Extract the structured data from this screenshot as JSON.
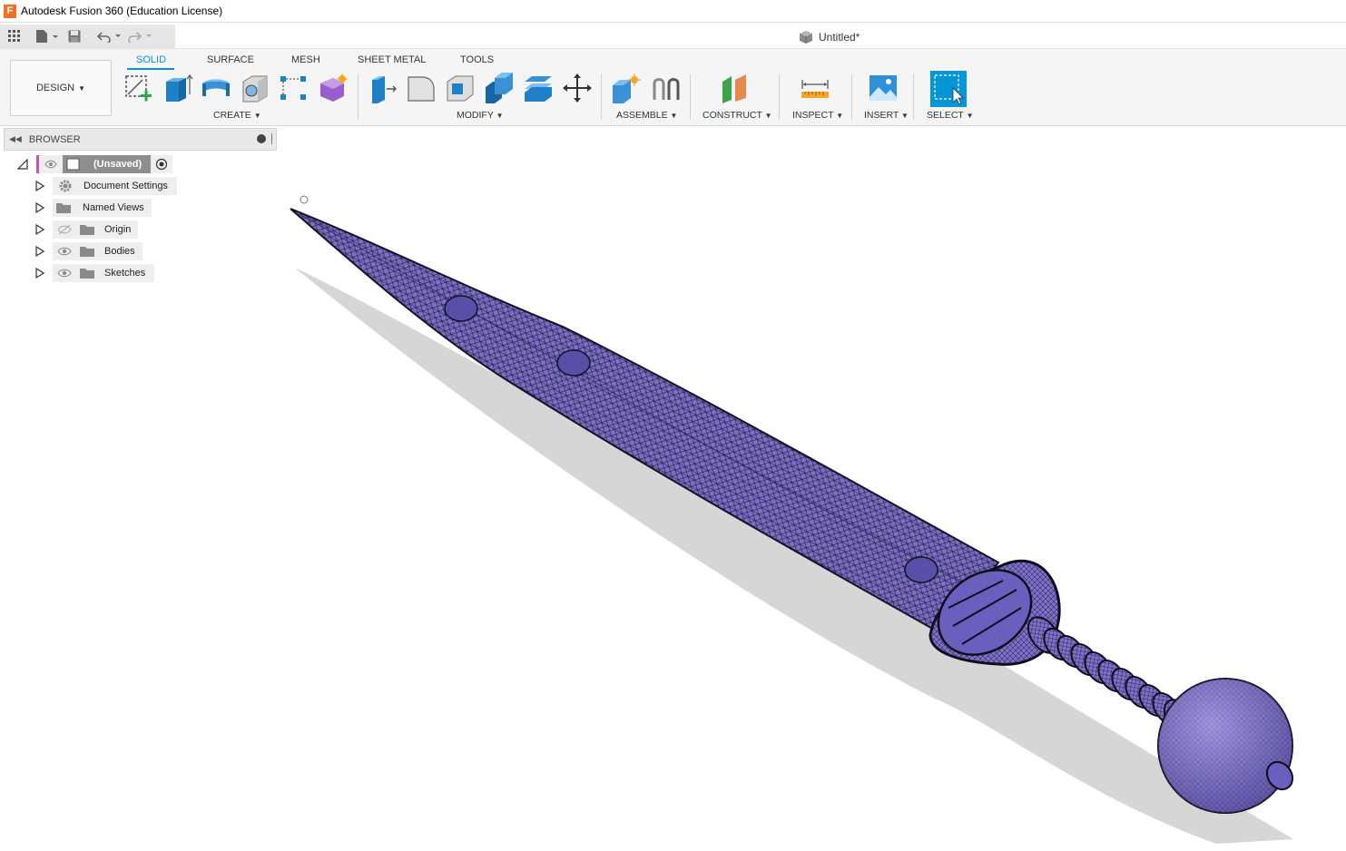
{
  "window": {
    "title": "Autodesk Fusion 360 (Education License)",
    "logo_letter": "F"
  },
  "document": {
    "tab_title": "Untitled*"
  },
  "workspace": {
    "label": "DESIGN"
  },
  "ribbon": {
    "tabs": [
      "SOLID",
      "SURFACE",
      "MESH",
      "SHEET METAL",
      "TOOLS"
    ],
    "active_tab": "SOLID",
    "groups": [
      "CREATE",
      "MODIFY",
      "ASSEMBLE",
      "CONSTRUCT",
      "INSPECT",
      "INSERT",
      "SELECT"
    ]
  },
  "browser": {
    "title": "BROWSER",
    "root": "(Unsaved)",
    "items": [
      "Document Settings",
      "Named Views",
      "Origin",
      "Bodies",
      "Sketches"
    ]
  },
  "colors": {
    "accent": "#0696d7",
    "model": "#7b6fc7",
    "mesh_line": "#1a1630",
    "shadow": "#cfcfcf"
  }
}
